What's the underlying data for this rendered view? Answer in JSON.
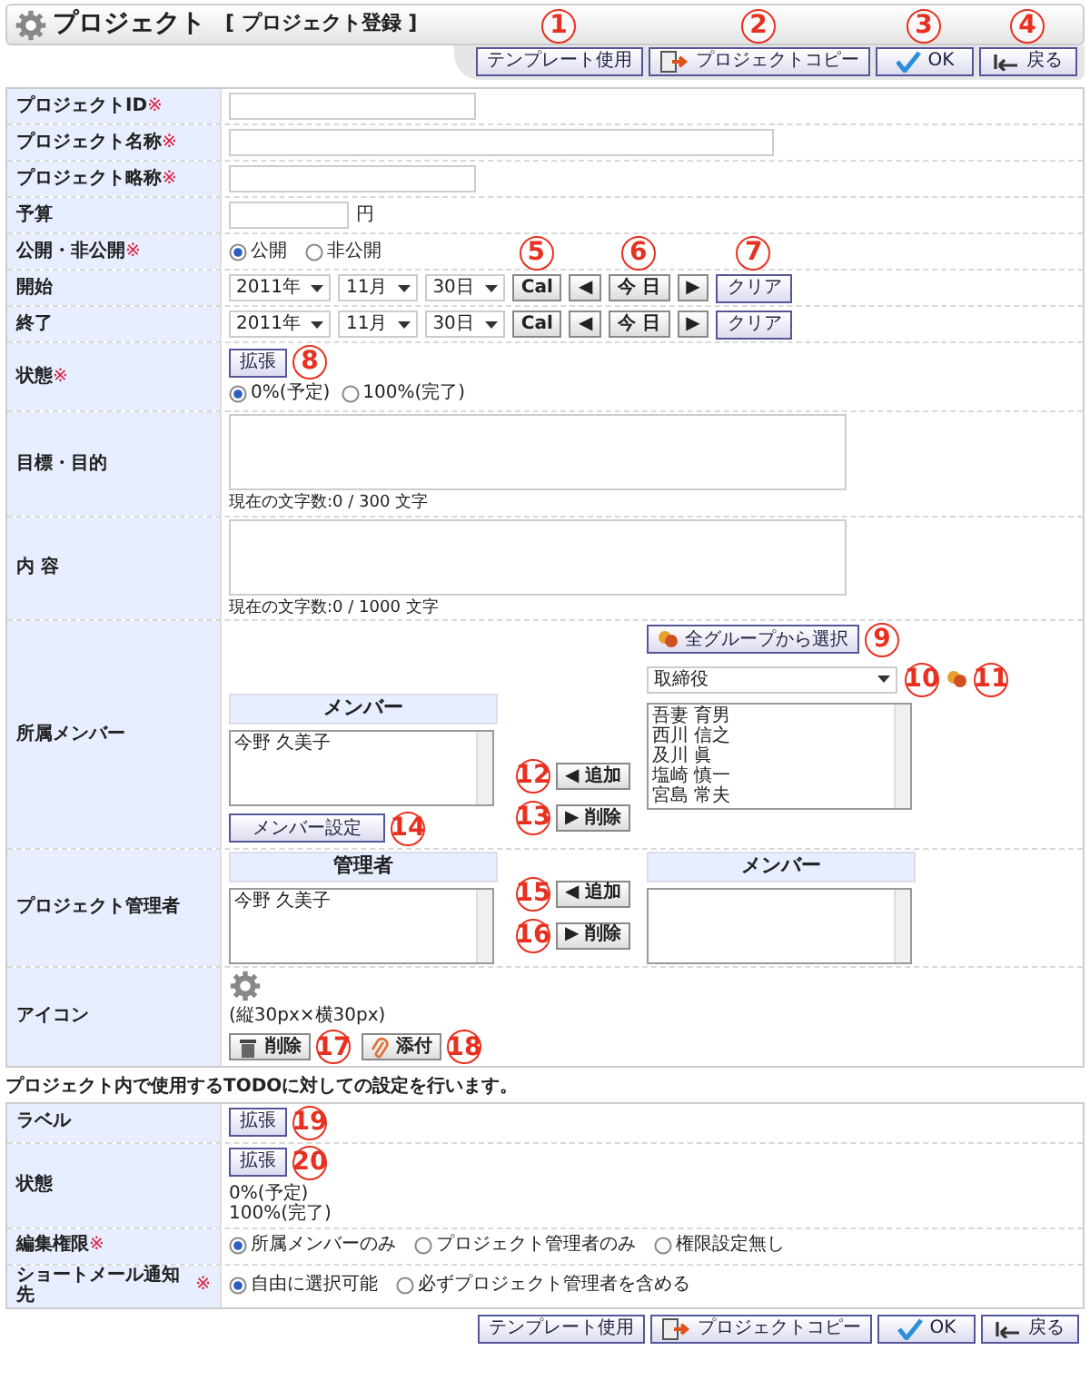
{
  "header": {
    "title": "プロジェクト",
    "subtitle": "[ プロジェクト登録 ]"
  },
  "top_buttons": [
    {
      "kind": "template",
      "label": "テンプレート使用",
      "callout": "1"
    },
    {
      "kind": "copy",
      "label": "プロジェクトコピー",
      "callout": "2"
    },
    {
      "kind": "ok",
      "label": "OK",
      "callout": "3"
    },
    {
      "kind": "back",
      "label": "戻る",
      "callout": "4"
    }
  ],
  "form": [
    {
      "kind": "text",
      "label": "プロジェクトID",
      "mark": "※"
    },
    {
      "kind": "wide_text",
      "label": "プロジェクト名称",
      "mark": "※"
    },
    {
      "kind": "text",
      "label": "プロジェクト略称",
      "mark": "※"
    },
    {
      "kind": "amount",
      "label": "予算",
      "unit": "円"
    },
    {
      "kind": "radio",
      "label": "公開・非公開",
      "mark": "※",
      "options": [
        {
          "label": "公開",
          "selected": true
        },
        {
          "label": "非公開",
          "selected": false
        }
      ]
    },
    {
      "kind": "date",
      "label": "開始",
      "year": "2011年",
      "month": "11月",
      "day": "30日",
      "cal": {
        "label": "Cal",
        "callout": "5"
      },
      "prev": "◀",
      "today": {
        "label": "今 日",
        "callout": "6"
      },
      "next": "▶",
      "clear": {
        "label": "クリア",
        "callout": "7"
      }
    },
    {
      "kind": "date",
      "label": "終了",
      "year": "2011年",
      "month": "11月",
      "day": "30日",
      "cal": {
        "label": "Cal"
      },
      "prev": "◀",
      "today": {
        "label": "今 日"
      },
      "next": "▶",
      "clear": {
        "label": "クリア"
      }
    },
    {
      "kind": "status",
      "label": "状態",
      "mark": "※",
      "expand": {
        "label": "拡張",
        "callout": "8"
      },
      "options": [
        {
          "label": "0%(予定)",
          "selected": true
        },
        {
          "label": "100%(完了)",
          "selected": false
        }
      ]
    },
    {
      "kind": "textarea",
      "label": "目標・目的",
      "counter": "現在の文字数:0 / 300 文字"
    },
    {
      "kind": "textarea",
      "label": "内 容",
      "counter": "現在の文字数:0 / 1000 文字"
    },
    {
      "kind": "transfer",
      "label": "所属メンバー",
      "left": {
        "title": "メンバー",
        "items": [
          "今野 久美子"
        ]
      },
      "setting_button": {
        "label": "メンバー設定",
        "callout": "14"
      },
      "add": {
        "arrow": "◀",
        "label": "追加",
        "callout": "12"
      },
      "remove": {
        "arrow": "▶",
        "label": "削除",
        "callout": "13"
      },
      "group_button": {
        "label": "全グループから選択",
        "callout": "9"
      },
      "group_select": {
        "value": "取締役",
        "callout": "10"
      },
      "group_icon_callout": "11",
      "right": {
        "items": [
          "吾妻 育男",
          "西川 信之",
          "及川 眞",
          "塩崎 慎一",
          "宮島 常夫"
        ]
      }
    },
    {
      "kind": "transfer",
      "label": "プロジェクト管理者",
      "left": {
        "title": "管理者",
        "items": [
          "今野 久美子"
        ]
      },
      "add": {
        "arrow": "◀",
        "label": "追加",
        "callout": "15"
      },
      "remove": {
        "arrow": "▶",
        "label": "削除",
        "callout": "16"
      },
      "right": {
        "title": "メンバー"
      }
    },
    {
      "kind": "icon",
      "label": "アイコン",
      "hint": "(縦30px×横30px)",
      "buttons": [
        {
          "kind": "delete",
          "label": "削除",
          "callout": "17"
        },
        {
          "kind": "attach",
          "label": "添付",
          "callout": "18"
        }
      ]
    }
  ],
  "todo_note": "プロジェクト内で使用するTODOに対しての設定を行います。",
  "todo_form": [
    {
      "kind": "status",
      "label": "ラベル",
      "expand": {
        "label": "拡張",
        "callout": "19"
      }
    },
    {
      "kind": "status",
      "label": "状態",
      "expand": {
        "label": "拡張",
        "callout": "20"
      },
      "lines": [
        "0%(予定)",
        "100%(完了)"
      ]
    },
    {
      "kind": "radio",
      "label": "編集権限",
      "mark": "※",
      "options": [
        {
          "label": "所属メンバーのみ",
          "selected": true
        },
        {
          "label": "プロジェクト管理者のみ",
          "selected": false
        },
        {
          "label": "権限設定無し",
          "selected": false
        }
      ]
    },
    {
      "kind": "radio",
      "label": "ショートメール通知先",
      "mark": "※",
      "options": [
        {
          "label": "自由に選択可能",
          "selected": true
        },
        {
          "label": "必ずプロジェクト管理者を含める",
          "selected": false
        }
      ]
    }
  ],
  "bottom_buttons": [
    {
      "kind": "template",
      "label": "テンプレート使用"
    },
    {
      "kind": "copy",
      "label": "プロジェクトコピー"
    },
    {
      "kind": "ok",
      "label": "OK"
    },
    {
      "kind": "back",
      "label": "戻る"
    }
  ]
}
